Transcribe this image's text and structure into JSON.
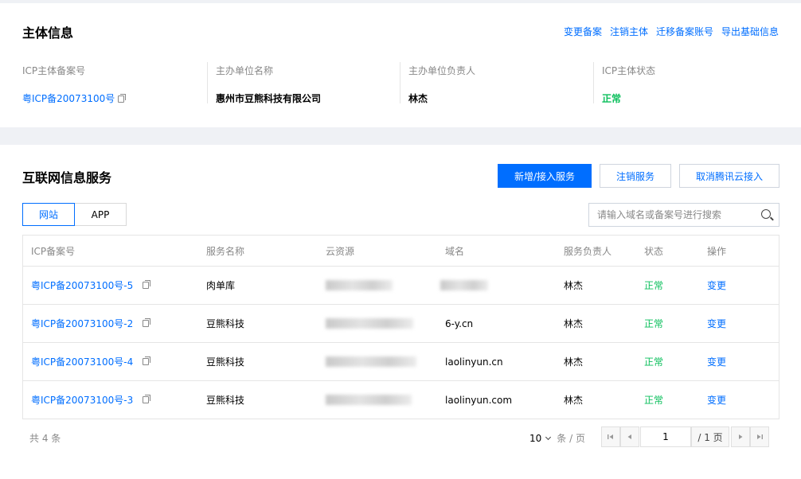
{
  "subject": {
    "title": "主体信息",
    "actions": [
      "变更备案",
      "注销主体",
      "迁移备案账号",
      "导出基础信息"
    ],
    "fields": [
      {
        "label": "ICP主体备案号",
        "value": "粤ICP备20073100号"
      },
      {
        "label": "主办单位名称",
        "value": "惠州市豆熊科技有限公司"
      },
      {
        "label": "主办单位负责人",
        "value": "林杰"
      },
      {
        "label": "ICP主体状态",
        "value": "正常"
      }
    ]
  },
  "services": {
    "title": "互联网信息服务",
    "buttons": {
      "add": "新增/接入服务",
      "cancel": "注销服务",
      "unlink": "取消腾讯云接入"
    },
    "tabs": [
      "网站",
      "APP"
    ],
    "search": {
      "placeholder": "请输入域名或备案号进行搜索"
    },
    "columns": [
      "ICP备案号",
      "服务名称",
      "云资源",
      "域名",
      "服务负责人",
      "状态",
      "操作"
    ],
    "rows": [
      {
        "icp": "粤ICP备20073100号-5",
        "name": "肉单库",
        "domain": "",
        "owner": "林杰",
        "status": "正常",
        "action": "变更"
      },
      {
        "icp": "粤ICP备20073100号-2",
        "name": "豆熊科技",
        "domain": "6-y.cn",
        "owner": "林杰",
        "status": "正常",
        "action": "变更"
      },
      {
        "icp": "粤ICP备20073100号-4",
        "name": "豆熊科技",
        "domain": "laolinyun.cn",
        "owner": "林杰",
        "status": "正常",
        "action": "变更"
      },
      {
        "icp": "粤ICP备20073100号-3",
        "name": "豆熊科技",
        "domain": "laolinyun.com",
        "owner": "林杰",
        "status": "正常",
        "action": "变更"
      }
    ],
    "footer": {
      "total": "共 4 条",
      "page_size": "10",
      "page_size_unit": "条 / 页",
      "current_page": "1",
      "total_pages": "/ 1 页"
    }
  },
  "colors": {
    "accent": "#006eff",
    "ok": "#0abf5b",
    "muted": "#888888"
  }
}
